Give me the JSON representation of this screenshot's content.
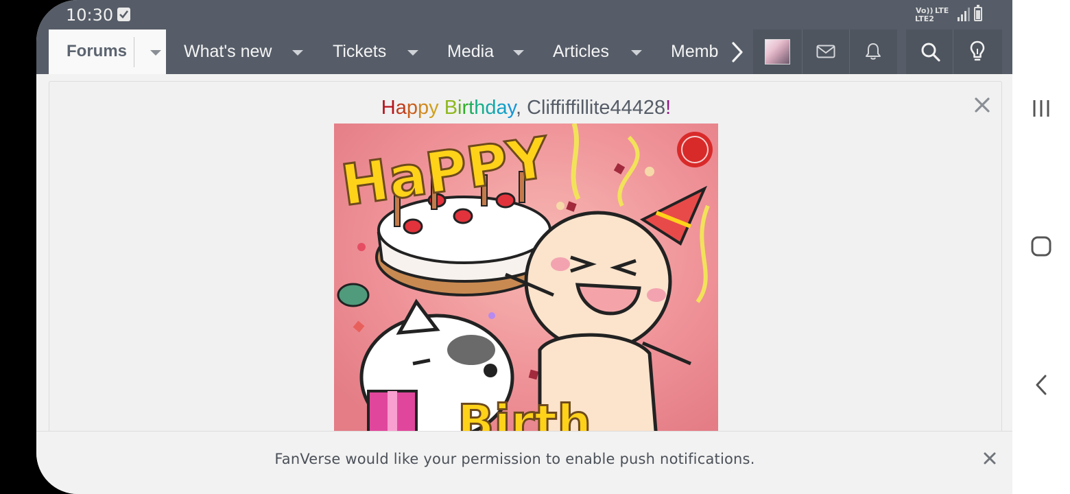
{
  "status_bar": {
    "time": "10:30",
    "network_top": "Vo))",
    "network_lte": "LTE",
    "network_lte2": "LTE2"
  },
  "nav": {
    "forums": "Forums",
    "whats_new": "What's new",
    "tickets": "Tickets",
    "media": "Media",
    "articles": "Articles",
    "members_partial": "Memb"
  },
  "notice": {
    "greeting_letters": [
      {
        "ch": "H",
        "color": "#b5121b"
      },
      {
        "ch": "a",
        "color": "#c0391a"
      },
      {
        "ch": "p",
        "color": "#c9601e"
      },
      {
        "ch": "p",
        "color": "#d08a1f"
      },
      {
        "ch": "y",
        "color": "#cfa11f"
      },
      {
        "ch": " ",
        "color": "#565d68"
      },
      {
        "ch": "B",
        "color": "#8fb81f"
      },
      {
        "ch": "i",
        "color": "#5bb31f"
      },
      {
        "ch": "r",
        "color": "#2faf2a"
      },
      {
        "ch": "t",
        "color": "#1fae5a"
      },
      {
        "ch": "h",
        "color": "#1aae86"
      },
      {
        "ch": "d",
        "color": "#14a8a8"
      },
      {
        "ch": "a",
        "color": "#12a0c4"
      },
      {
        "ch": "y",
        "color": "#1496d8"
      }
    ],
    "name_text": ", Cliffiffillite44428",
    "exclamation": "!",
    "exclamation_color": "#8e1a86"
  },
  "push": {
    "message": "FanVerse would like your permission to enable push notifications."
  },
  "colors": {
    "nav_bg": "#565d68",
    "page_bg": "#f2f2f2"
  }
}
